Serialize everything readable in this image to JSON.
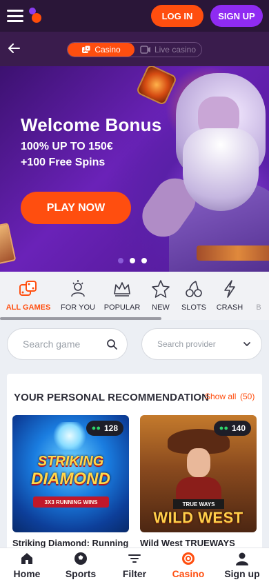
{
  "header": {
    "login_label": "LOG IN",
    "signup_label": "SIGN UP"
  },
  "mode_toggle": {
    "casino_label": "Casino",
    "live_label": "Live casino",
    "active": "Casino"
  },
  "banner": {
    "title": "Welcome Bonus",
    "line1": "100% UP TO 150€",
    "line2": "+100 Free Spins",
    "cta_label": "PLAY NOW",
    "slide_count": 3,
    "active_slide": 1
  },
  "categories": [
    {
      "label": "ALL GAMES",
      "icon": "dice-icon",
      "active": true
    },
    {
      "label": "FOR YOU",
      "icon": "star-person-icon",
      "active": false
    },
    {
      "label": "POPULAR",
      "icon": "crown-icon",
      "active": false
    },
    {
      "label": "NEW",
      "icon": "star-icon",
      "active": false
    },
    {
      "label": "SLOTS",
      "icon": "cherries-icon",
      "active": false
    },
    {
      "label": "CRASH",
      "icon": "lightning-icon",
      "active": false
    },
    {
      "label": "B",
      "icon": "more-icon",
      "active": false
    }
  ],
  "search": {
    "game_placeholder": "Search game",
    "provider_placeholder": "Search provider"
  },
  "recommendation": {
    "title": "YOUR PERSONAL RECOMMENDATION",
    "show_all_label": "Show all",
    "count": "(50)",
    "games": [
      {
        "name": "Striking Diamond: Running",
        "players": "128",
        "logo_line1": "STRIKING",
        "logo_line2": "DIAMOND",
        "tag": "3X3 RUNNING WINS"
      },
      {
        "name": "Wild West TRUEWAYS",
        "players": "140",
        "logo_line1": "WILD WEST",
        "tag": "TRUE WAYS"
      }
    ]
  },
  "bottom_nav": [
    {
      "label": "Home",
      "icon": "home-icon",
      "active": false
    },
    {
      "label": "Sports",
      "icon": "soccer-ball-icon",
      "active": false
    },
    {
      "label": "Filter",
      "icon": "filter-icon",
      "active": false
    },
    {
      "label": "Casino",
      "icon": "casino-chip-icon",
      "active": true
    },
    {
      "label": "Sign up",
      "icon": "user-icon",
      "active": false
    }
  ],
  "colors": {
    "accent": "#ff4e0f",
    "brand_purple": "#8f2bf2",
    "header_bg": "#2a1638"
  }
}
